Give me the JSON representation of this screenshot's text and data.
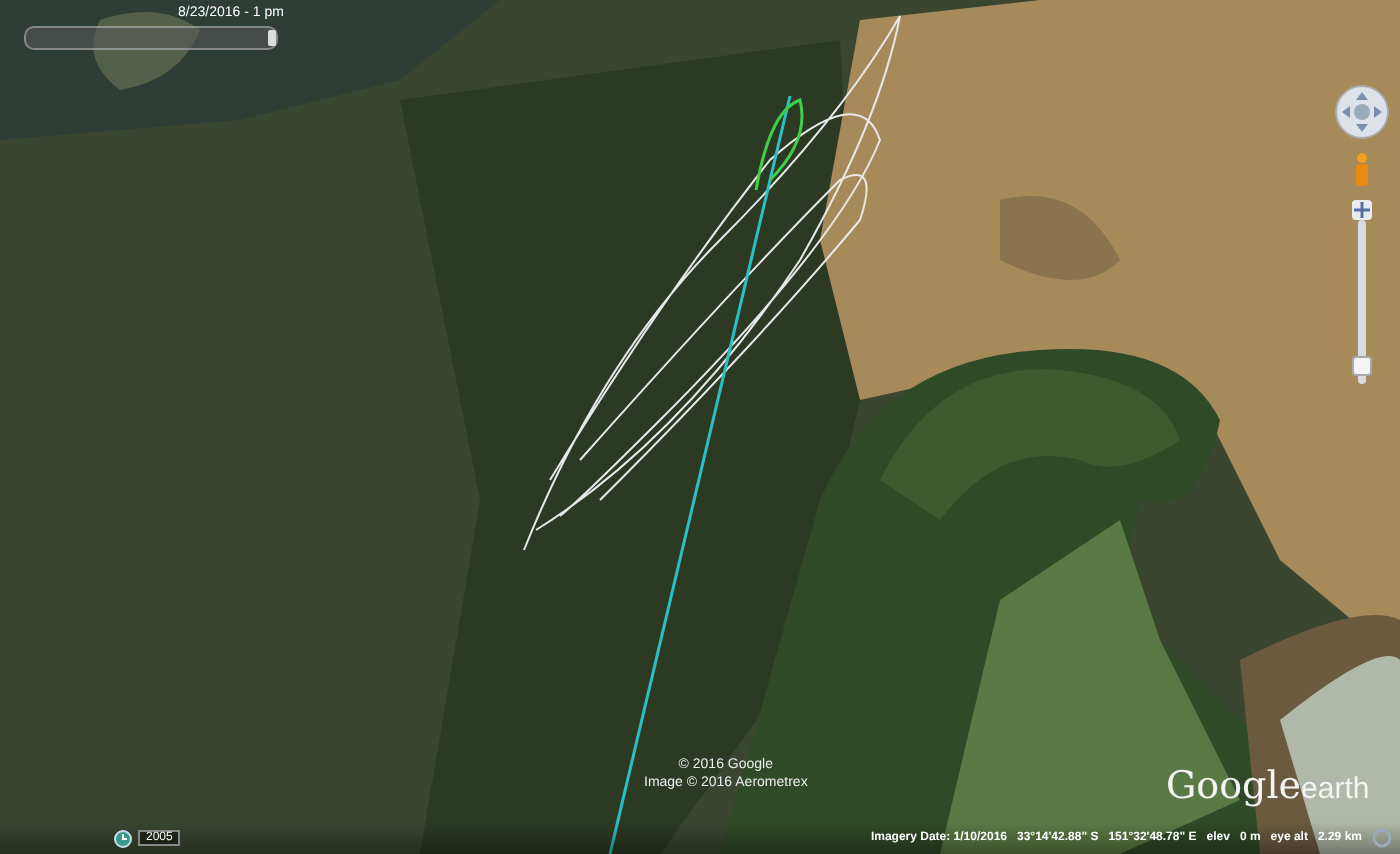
{
  "time_slider": {
    "label": "8/23/2016 - 1 pm",
    "level": 1
  },
  "navigation": {
    "zoom": {
      "level": 0.05
    }
  },
  "attribution": [
    "© 2016 Google",
    "Image © 2016 Aerometrex"
  ],
  "historical_imagery": {
    "year": "2005"
  },
  "logo": {
    "word_1": "Google",
    "word_2": "earth"
  },
  "status_bar": {
    "imagery_date": "Imagery Date: 1/10/2016",
    "latitude": "33°14'42.88\" S",
    "longitude": "151°32'48.78\" E",
    "elevation_label": "elev",
    "elevation": "0 m",
    "eye_alt_label": "eye alt",
    "eye_alt": "2.29 km"
  }
}
